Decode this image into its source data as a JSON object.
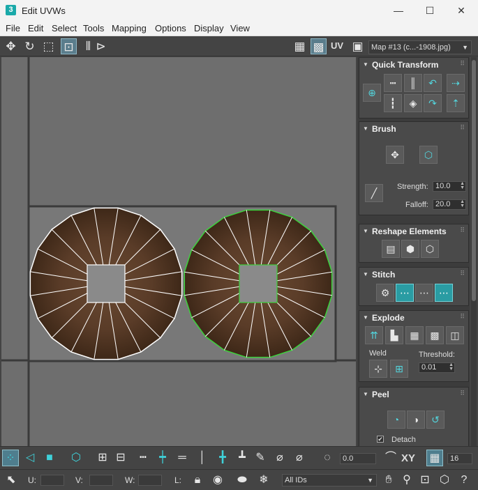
{
  "window": {
    "title": "Edit UVWs",
    "app_icon_text": "3",
    "minimize": "—",
    "maximize": "☐",
    "close": "✕"
  },
  "menu": [
    "File",
    "Edit",
    "Select",
    "Tools",
    "Mapping",
    "Options",
    "Display",
    "View"
  ],
  "toolbar": {
    "uv_label": "UV",
    "map_select": "Map #13 (c...-1908.jpg)"
  },
  "panel": {
    "quick_transform": {
      "title": "Quick Transform"
    },
    "brush": {
      "title": "Brush",
      "strength_label": "Strength:",
      "strength_value": "10.0",
      "falloff_label": "Falloff:",
      "falloff_value": "20.0"
    },
    "reshape": {
      "title": "Reshape Elements"
    },
    "stitch": {
      "title": "Stitch"
    },
    "explode": {
      "title": "Explode",
      "weld_label": "Weld",
      "threshold_label": "Threshold:",
      "threshold_value": "0.01"
    },
    "peel": {
      "title": "Peel",
      "detach_label": "Detach",
      "detach_checked": "✔"
    }
  },
  "bottom": {
    "angle_value": "0.0",
    "xy_label": "XY",
    "grid_value": "16",
    "u_label": "U:",
    "v_label": "V:",
    "w_label": "W:",
    "l_label": "L:",
    "ids_select": "All IDs"
  },
  "colors": {
    "accent": "#1aa9a9",
    "selected_edge": "#3cd23c",
    "viewport_bg": "#6e6e6e",
    "panel_bg": "#3c3c3c"
  }
}
